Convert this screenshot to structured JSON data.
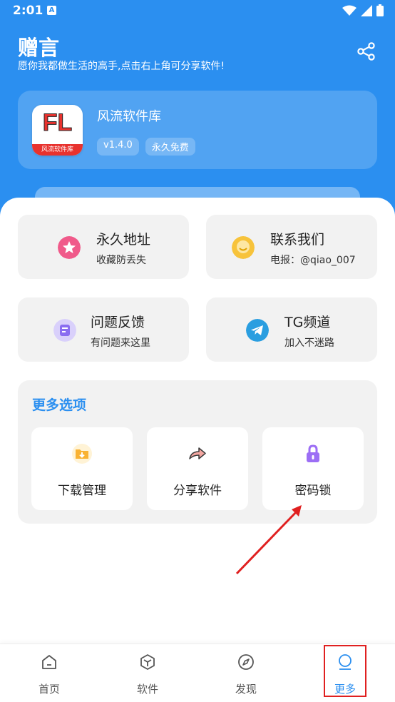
{
  "status": {
    "time": "2:01",
    "a_badge": "A"
  },
  "header": {
    "title": "赠言",
    "subtitle": "愿你我都做生活的高手,点击右上角可分享软件!",
    "share_icon": "share-icon"
  },
  "app": {
    "logo_text": "FL",
    "logo_band": "风流软件库",
    "name": "风流软件库",
    "version": "v1.4.0",
    "tag": "永久免费"
  },
  "quick_cards": [
    {
      "title": "永久地址",
      "subtitle": "收藏防丢失",
      "icon": "star-icon",
      "color": "#f05a8a"
    },
    {
      "title": "联系我们",
      "subtitle": "电报：@qiao_007",
      "icon": "chat-icon",
      "color": "#f7c33b"
    },
    {
      "title": "问题反馈",
      "subtitle": "有问题来这里",
      "icon": "feedback-icon",
      "color": "#8a6df0"
    },
    {
      "title": "TG频道",
      "subtitle": "加入不迷路",
      "icon": "telegram-icon",
      "color": "#2a9ee0"
    }
  ],
  "more": {
    "title": "更多选项",
    "options": [
      {
        "label": "下载管理",
        "icon": "download-folder-icon"
      },
      {
        "label": "分享软件",
        "icon": "share-arrow-icon"
      },
      {
        "label": "密码锁",
        "icon": "lock-icon"
      }
    ]
  },
  "tabs": [
    {
      "label": "首页",
      "icon": "home-icon"
    },
    {
      "label": "软件",
      "icon": "box-icon"
    },
    {
      "label": "发现",
      "icon": "compass-icon"
    },
    {
      "label": "更多",
      "icon": "user-icon",
      "active": true
    }
  ],
  "colors": {
    "primary": "#2b8ff0",
    "highlight": "#e02020"
  }
}
